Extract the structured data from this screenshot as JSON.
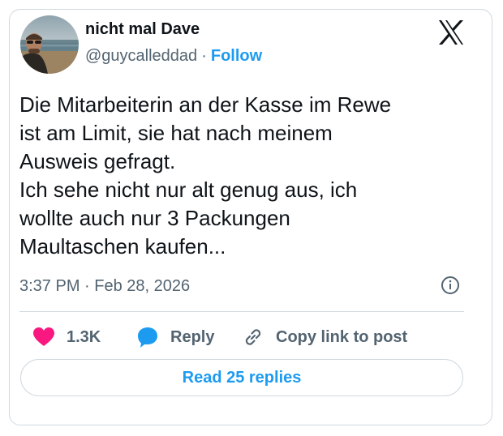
{
  "author": {
    "name": "nicht mal Dave",
    "handle": "@guycalleddad",
    "separator": "·",
    "follow_label": "Follow",
    "avatar_icon": "profile-photo"
  },
  "platform_icon": "x-logo",
  "post": {
    "lines": [
      "Die Mitarbeiterin an der Kasse im Rewe",
      "ist am Limit, sie hat nach meinem",
      "Ausweis gefragt.",
      "Ich sehe nicht nur alt genug aus, ich",
      "wollte auch nur 3 Packungen",
      "Maultaschen kaufen..."
    ],
    "time": "3:37 PM",
    "separator": "·",
    "date": "Feb 28, 2026"
  },
  "actions": {
    "like_count": "1.3K",
    "reply_label": "Reply",
    "copy_label": "Copy link to post"
  },
  "read_replies_label": "Read 25 replies",
  "colors": {
    "accent": "#1d9bf0",
    "like": "#f91880",
    "text": "#0f1419",
    "secondary": "#536471",
    "border": "#cfd9de"
  }
}
